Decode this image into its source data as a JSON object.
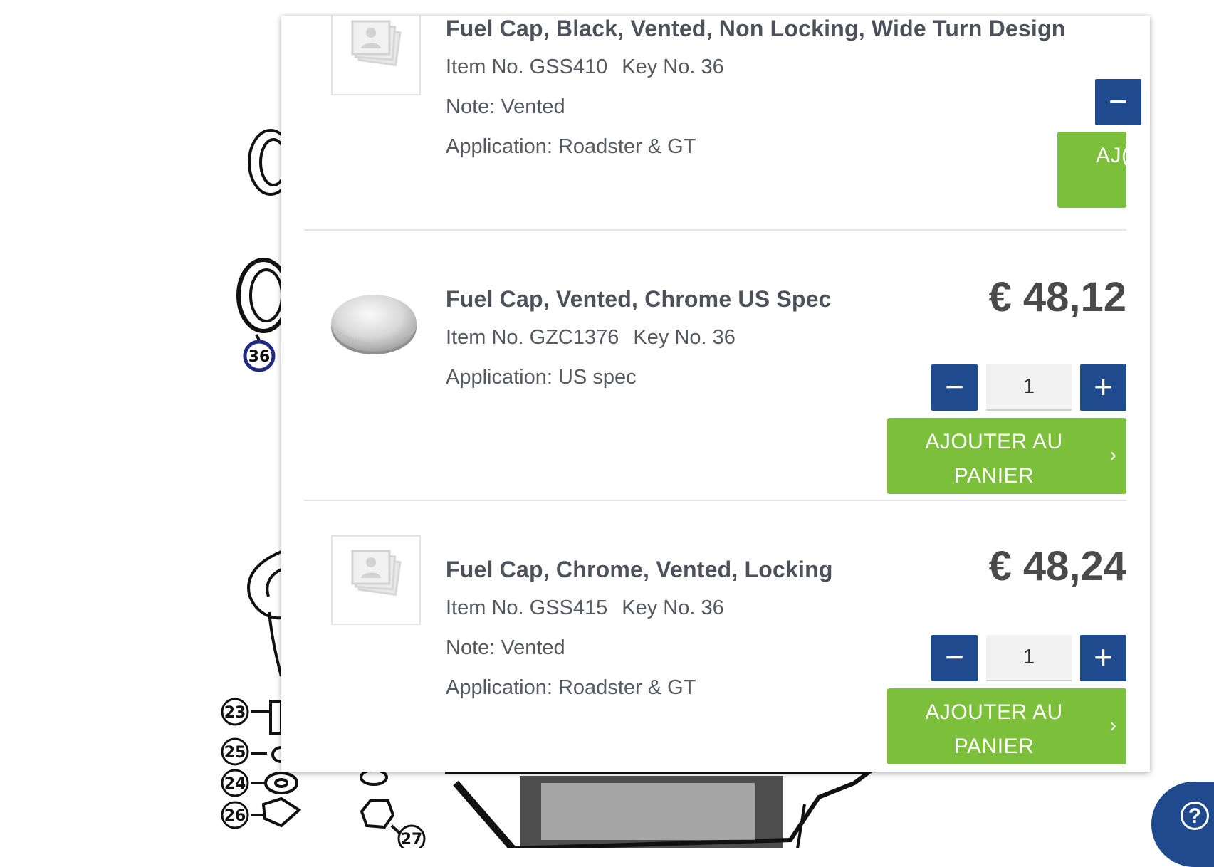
{
  "diagram": {
    "callouts": [
      "36",
      "23",
      "25",
      "24",
      "26",
      "27"
    ]
  },
  "products": [
    {
      "title": "Fuel Cap, Black, Vented, Non Locking, Wide Turn Design",
      "item_no": "Item No. GSS410",
      "key_no": "Key No. 36",
      "note": "Note: Vented",
      "application": "Application: Roadster & GT",
      "qty_minus": "−",
      "add_to_cart": "AJOUTER AU PANIER",
      "add_to_cart_visible": "AJ(",
      "image": "placeholder-image"
    },
    {
      "title": "Fuel Cap, Vented, Chrome US Spec",
      "item_no": "Item No. GZC1376",
      "key_no": "Key No. 36",
      "application": "Application: US spec",
      "price": "€ 48,12",
      "qty": "1",
      "qty_minus": "−",
      "qty_plus": "+",
      "add_to_cart_line1": "AJOUTER AU",
      "add_to_cart_line2": "PANIER",
      "chevron": "›",
      "image": "chrome-fuel-cap-photo"
    },
    {
      "title": "Fuel Cap, Chrome, Vented, Locking",
      "item_no": "Item No. GSS415",
      "key_no": "Key No. 36",
      "note": "Note: Vented",
      "application": "Application: Roadster & GT",
      "price": "€ 48,24",
      "qty": "1",
      "qty_minus": "−",
      "qty_plus": "+",
      "add_to_cart_line1": "AJOUTER AU",
      "add_to_cart_line2": "PANIER",
      "chevron": "›",
      "image": "placeholder-image"
    }
  ],
  "help": {
    "icon": "help-question-icon",
    "glyph": "?"
  },
  "colors": {
    "accent_blue": "#1f4a8e",
    "cart_green": "#7bbf3a",
    "title_gray": "#4d5159"
  }
}
